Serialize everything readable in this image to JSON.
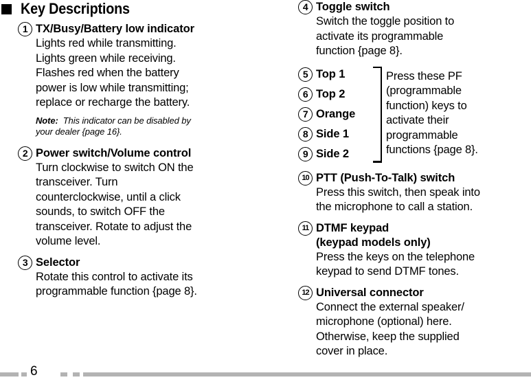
{
  "page": {
    "number": "6"
  },
  "heading": {
    "bullet": "square-bullet",
    "title": "Key Descriptions"
  },
  "left_column": {
    "entries": [
      {
        "num": "1",
        "title": "TX/Busy/Battery low indicator",
        "lines": [
          "Lights red while transmitting.",
          "Lights green while receiving.",
          "Flashes red when the battery",
          "power is low while transmitting;",
          "replace or recharge the battery."
        ],
        "note": {
          "label": "Note:",
          "lines": [
            "This indicator can be disabled by",
            "your dealer {page 16}."
          ]
        }
      },
      {
        "num": "2",
        "title": "Power switch/Volume control",
        "lines": [
          "Turn clockwise to switch ON the",
          "transceiver.  Turn",
          "counterclockwise, until a click",
          "sounds, to switch OFF the",
          "transceiver.  Rotate to adjust the",
          "volume level."
        ]
      },
      {
        "num": "3",
        "title": "Selector",
        "lines": [
          "Rotate this control to activate its",
          "programmable function {page 8}."
        ]
      }
    ]
  },
  "right_column": {
    "entries_top": [
      {
        "num": "4",
        "title": "Toggle switch",
        "lines": [
          "Switch the toggle position to",
          "activate its programmable",
          "function {page 8}."
        ]
      }
    ],
    "pf_group": {
      "items": [
        {
          "num": "5",
          "title": "Top 1"
        },
        {
          "num": "6",
          "title": "Top 2"
        },
        {
          "num": "7",
          "title": "Orange"
        },
        {
          "num": "8",
          "title": "Side 1"
        },
        {
          "num": "9",
          "title": "Side 2"
        }
      ],
      "bracket": "right-brace-bracket",
      "caption_lines": [
        "Press these PF",
        "(programmable",
        "function) keys to",
        "activate their",
        "programmable",
        "functions {page 8}."
      ]
    },
    "entries_bottom": [
      {
        "num": "10",
        "title": "PTT (Push-To-Talk) switch",
        "lines": [
          "Press this switch, then speak into",
          "the microphone to call a station."
        ]
      },
      {
        "num": "11",
        "title": "DTMF keypad",
        "title2": "(keypad models only)",
        "lines": [
          "Press the keys on the telephone",
          "keypad to send DTMF tones."
        ]
      },
      {
        "num": "12",
        "title": "Universal connector",
        "lines": [
          "Connect the external speaker/",
          "microphone (optional) here.",
          "Otherwise, keep the supplied",
          "cover in place."
        ]
      }
    ]
  },
  "footer": {
    "page_number": "6",
    "accent_color": "#b3b3b3"
  }
}
